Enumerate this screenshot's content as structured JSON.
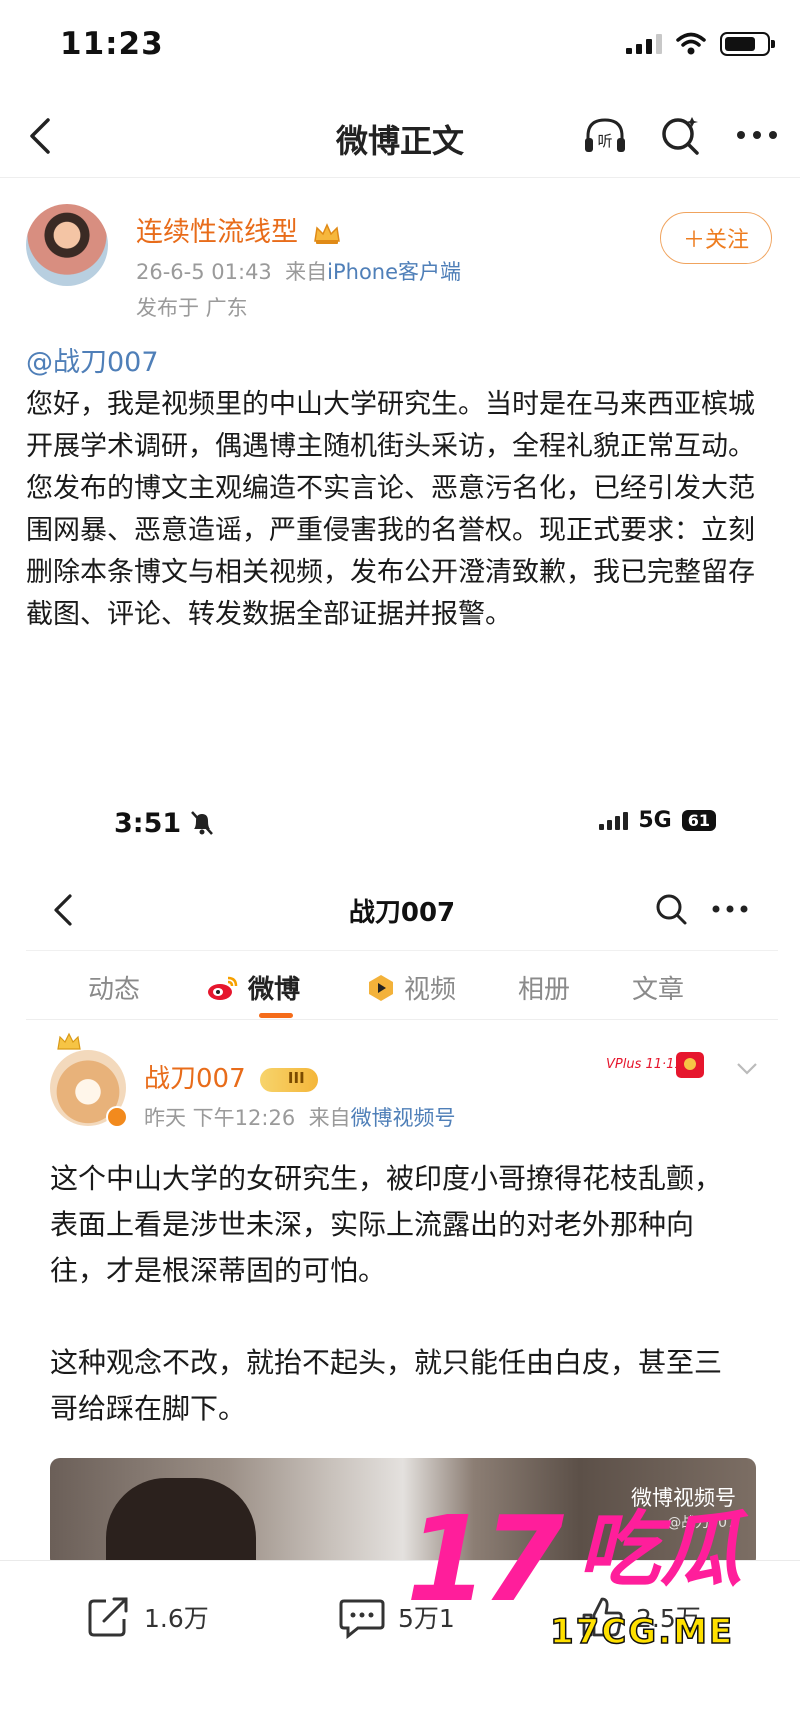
{
  "status_bar": {
    "time": "11:23"
  },
  "nav": {
    "title": "微博正文",
    "listen_label": "听"
  },
  "post": {
    "author": "连续性流线型",
    "timestamp": "26-6-5 01:43",
    "source_prefix": "来自",
    "source": "iPhone客户端",
    "location": "发布于 广东",
    "follow_label": "＋关注",
    "mention": "@战刀007",
    "paragraph1": "您好，我是视频里的中山大学研究生。当时是在马来西亚槟城开展学术调研，偶遇博主随机街头采访，全程礼貌正常互动。",
    "paragraph2": "您发布的博文主观编造不实言论、恶意污名化，已经引发大范围网暴、恶意造谣，严重侵害我的名誉权。现正式要求：立刻删除本条博文与相关视频，发布公开澄清致歉，我已完整留存截图、评论、转发数据全部证据并报警。"
  },
  "embedded": {
    "status_time": "3:51",
    "network": "5G",
    "battery": "61",
    "title": "战刀007",
    "tabs": [
      {
        "label": "动态"
      },
      {
        "label": "微博"
      },
      {
        "label": "视频"
      },
      {
        "label": "相册"
      },
      {
        "label": "文章"
      }
    ],
    "author": "战刀007",
    "level_badge": "III",
    "time": "昨天 下午12:26",
    "source_prefix": "来自",
    "source": "微博视频号",
    "vplus": "VPlus 11·11",
    "paragraph1": "这个中山大学的女研究生，被印度小哥撩得花枝乱颤，表面上看是涉世未深，实际上流露出的对老外那种向往，才是根深蒂固的可怕。",
    "paragraph2": "这种观念不改，就抬不起头，就只能任由白皮，甚至三哥给踩在脚下。",
    "video_label": "微博视频号",
    "video_sub": "@战刀007"
  },
  "actions": {
    "share_count": "1.6万",
    "comment_count": "5万1",
    "like_count": "2.5万"
  },
  "watermark": {
    "number": "17",
    "text": "吃瓜",
    "url": "17CG.ME"
  },
  "colors": {
    "accent": "#e86c1a",
    "link": "#4f7fb8",
    "watermark": "#ff1e9b"
  }
}
